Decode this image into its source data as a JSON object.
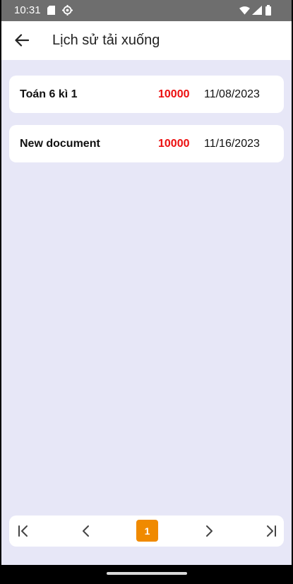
{
  "status_bar": {
    "time": "10:31",
    "icons": [
      "sim-card-icon",
      "settings-icon",
      "wifi-icon",
      "signal-icon",
      "battery-icon"
    ]
  },
  "app_bar": {
    "back_icon": "arrow-left-icon",
    "title": "Lịch sử tải xuống"
  },
  "downloads": [
    {
      "name": "Toán 6 kì 1",
      "price": "10000",
      "date": "11/08/2023"
    },
    {
      "name": "New document",
      "price": "10000",
      "date": "11/16/2023"
    }
  ],
  "pagination": {
    "current_page": "1",
    "icons": [
      "first-page-icon",
      "previous-page-icon",
      "next-page-icon",
      "last-page-icon"
    ]
  },
  "colors": {
    "background": "#e7e7f7",
    "price": "#ec0f0f",
    "active_page": "#f08a00",
    "status_bar": "#6e6e6e"
  }
}
